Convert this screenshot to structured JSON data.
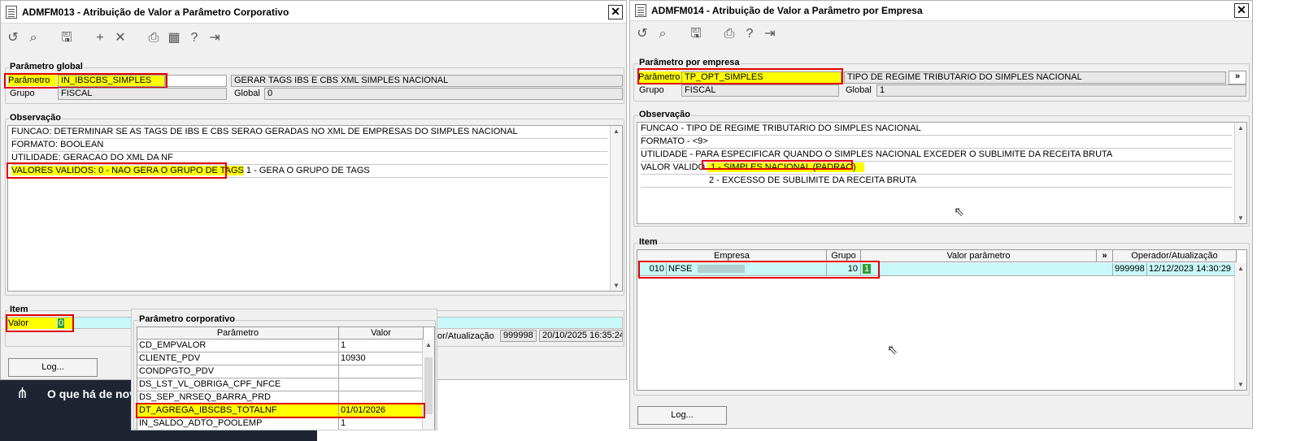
{
  "win1": {
    "title": "ADMFM013 - Atribuição de Valor a Parâmetro Corporativo",
    "close": "✕",
    "param_group": {
      "label": "Parâmetro global",
      "param_label": "Parâmetro",
      "param_value": "IN_IBSCBS_SIMPLES",
      "param_desc": "GERAR TAGS IBS E CBS XML SIMPLES NACIONAL",
      "group_label": "Grupo",
      "group_value": "FISCAL",
      "global_label": "Global",
      "global_value": "0"
    },
    "obs": {
      "label": "Observação",
      "lines": [
        "FUNCAO: DETERMINAR SE AS TAGS DE IBS E CBS SERAO GERADAS NO XML DE EMPRESAS DO SIMPLES NACIONAL",
        "FORMATO: BOOLEAN",
        "UTILIDADE: GERACAO DO XML DA NF"
      ],
      "line4_a": "VALORES VALIDOS: 0 - NAO GERA O GRUPO DE TAGS",
      "line4_b": " 1 - GERA O GRUPO DE TAGS"
    },
    "item": {
      "label": "Item",
      "valor_label": "Valor",
      "valor_value": "0",
      "oper_label": "or/Atualização",
      "oper_user": "999998",
      "oper_date": "20/10/2025 16:35:24"
    },
    "log_button": "Log..."
  },
  "popup": {
    "label": "Parâmetro corporativo",
    "col_param": "Parâmetro",
    "col_valor": "Valor",
    "rows": [
      {
        "param": "CD_EMPVALOR",
        "valor": "1"
      },
      {
        "param": "CLIENTE_PDV",
        "valor": "10930"
      },
      {
        "param": "CONDPGTO_PDV",
        "valor": ""
      },
      {
        "param": "DS_LST_VL_OBRIGA_CPF_NFCE",
        "valor": ""
      },
      {
        "param": "DS_SEP_NRSEQ_BARRA_PRD",
        "valor": ""
      },
      {
        "param": "DT_AGREGA_IBSCBS_TOTALNF",
        "valor": "01/01/2026"
      },
      {
        "param": "IN_SALDO_ADTO_POOLEMP",
        "valor": "1"
      }
    ]
  },
  "banner": {
    "text": "O que há de nov"
  },
  "win2": {
    "title": "ADMFM014 - Atribuição de Valor a Parâmetro por Empresa",
    "close": "✕",
    "param_group": {
      "label": "Parâmetro por empresa",
      "param_label": "Parâmetro",
      "param_value": "TP_OPT_SIMPLES",
      "param_desc": "TIPO DE REGIME TRIBUTARIO DO SIMPLES NACIONAL",
      "more": "»",
      "group_label": "Grupo",
      "group_value": "FISCAL",
      "global_label": "Global",
      "global_value": "1"
    },
    "obs": {
      "label": "Observação",
      "lines": [
        "FUNCAO - TIPO DE REGIME TRIBUTARIO DO SIMPLES NACIONAL",
        "FORMATO - <9>",
        "UTILIDADE - PARA ESPECIFICAR QUANDO O SIMPLES NACIONAL EXCEDER O SUBLIMITE DA RECEITA BRUTA"
      ],
      "line4_a": "VALOR VALIDO ",
      "line4_b": "1 - SIMPLES NACIONAL (PADRAO)",
      "line5": "2 - EXCESSO DE SUBLIMITE DA RECEITA BRUTA"
    },
    "item": {
      "label": "Item",
      "col_empresa": "Empresa",
      "col_grupo": "Grupo",
      "col_valor": "Valor parâmetro",
      "col_more": "»",
      "col_oper": "Operador/Atualização",
      "row": {
        "code": "010",
        "empresa": "NFSE",
        "grupo": "10",
        "valor": "1",
        "user": "999998",
        "date": "12/12/2023 14:30:29"
      }
    },
    "log_button": "Log..."
  }
}
